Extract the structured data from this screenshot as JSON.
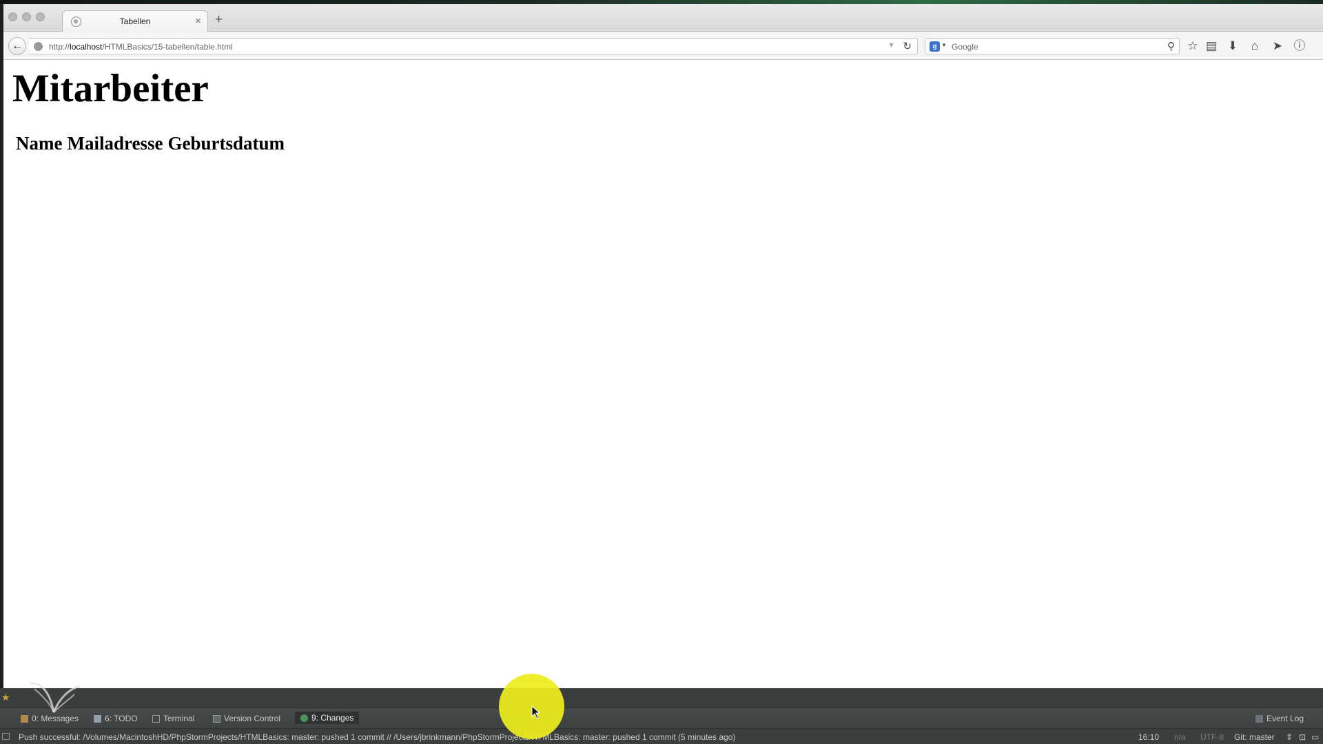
{
  "browser": {
    "tab_title": "Tabellen",
    "tab_close": "×",
    "new_tab": "+",
    "back_glyph": "←",
    "url_prefix": "http://",
    "url_host": "localhost",
    "url_path": "/HTMLBasics/15-tabellen/table.html",
    "reload_glyph": "↻",
    "search_engine_letter": "g",
    "search_placeholder": "Google",
    "toolbar_icons": [
      "star-icon",
      "reading-list-icon",
      "download-icon",
      "home-icon",
      "send-icon",
      "info-icon"
    ]
  },
  "page": {
    "heading": "Mitarbeiter",
    "table_headers": [
      "Name",
      "Mailadresse",
      "Geburtsdatum"
    ]
  },
  "ide": {
    "tool_windows": [
      {
        "label": "0: Messages",
        "icon": "messages-icon"
      },
      {
        "label": "6: TODO",
        "icon": "todo-icon"
      },
      {
        "label": "Terminal",
        "icon": "terminal-icon"
      },
      {
        "label": "Version Control",
        "icon": "version-control-icon"
      },
      {
        "label": "9: Changes",
        "icon": "changes-icon",
        "active": true
      }
    ],
    "event_log": "Event Log",
    "status_message": "Push successful: /Volumes/MacintoshHD/PhpStormProjects/HTMLBasics: master: pushed 1 commit // /Users/jbrinkmann/PhpStormProjects/HTMLBasics: master: pushed 1 commit (5 minutes ago)",
    "cursor_position": "16:10",
    "line_separator": "n/a",
    "encoding": "UTF-8",
    "vcs_branch": "Git: master"
  },
  "colors": {
    "cursor_highlight": "#ECEE1E",
    "search_engine": "#3B71CF"
  }
}
